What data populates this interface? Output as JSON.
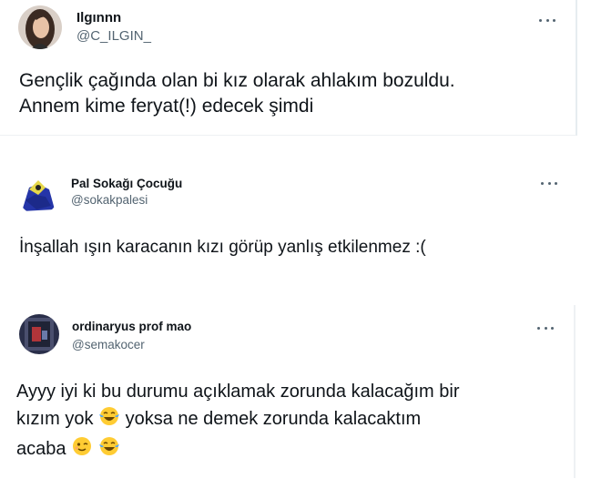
{
  "tweets": [
    {
      "display_name": "Ilgınnn",
      "handle": "@C_ILGIN_",
      "lines": [
        "Gençlik çağında olan bi kız olarak ahlakım bozuldu.",
        "Annem kime feryat(!) edecek şimdi"
      ]
    },
    {
      "display_name": "Pal Sokağı Çocuğu",
      "handle": "@sokakpalesi",
      "lines": [
        "İnşallah ışın karacanın kızı görüp yanlış etkilenmez :("
      ]
    },
    {
      "display_name": "ordinaryus prof mao",
      "handle": "@semakocer",
      "lines": [
        "Ayyy iyi ki bu durumu açıklamak zorunda kalacağım bir",
        "kızım yok",
        "yoksa ne demek zorunda kalacaktım",
        "acaba"
      ],
      "emojis": [
        "tears-of-joy-emoji",
        "winking-face-emoji"
      ]
    }
  ],
  "colors": {
    "text": "#0f1419",
    "secondary": "#536471",
    "divider": "#e6ecf0"
  }
}
